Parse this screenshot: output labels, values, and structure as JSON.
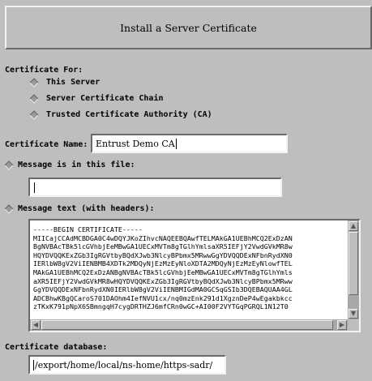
{
  "header": {
    "title": "Install a Server Certificate"
  },
  "certificate_for": {
    "label": "Certificate For:",
    "options": [
      "This Server",
      "Server Certificate Chain",
      "Trusted Certificate Authority (CA)"
    ]
  },
  "certificate_name": {
    "label": "Certificate Name:",
    "value": "Entrust Demo CA"
  },
  "message_file": {
    "label": "Message is in this file:",
    "value": ""
  },
  "message_text": {
    "label": "Message text (with headers):",
    "lines": [
      "-----BEGIN CERTIFICATE-----",
      "MIICajCCAdMCBDGA0C4wDQYJKoZIhvcNAQEEBQAwfTELMAkGA1UEBhMCQ2ExDzAN",
      "BgNVBAcTBk5lcGVhbjEeMBwGA1UECxMVTm8gTGlhYmlsaXR5IEFjY2VwdGVkMR8w",
      "HQYDVQQKExZGb3IgRGVtbyBQdXJwb3NlcyBPbmx5MRwwGgYDVQQDExNFbnRydXN0",
      "IERlbW8gV2ViIENBMB4XDTk2MDQyNjEzMzEyNloXDTA2MDQyNjEzMzEyNlowfTEL",
      "MAkGA1UEBhMCQ2ExDzANBgNVBAcTBk5lcGVhbjEeMBwGA1UECxMVTm8gTGlhYmls",
      "aXR5IEFjY2VwdGVkMR8wHQYDVQQKExZGb3IgRGVtbyBQdXJwb3NlcyBPbmx5MRww",
      "GgYDVQQDExNFbnRydXN0IERlbW8gV2ViIENBMIGdMA0GCSqGSIb3DQEBAQUAA4GL",
      "ADCBhwKBgQCaroS701DAOhm4IefNVU1cx/nq0mzEnk291d1XgznDeP4wEgakbkcc",
      "zTKxK791pNpX6SBmngqH7cygDRTHZJ6mfCRn0wGC+AI00F2VYTGqPGRQL1N12T0"
    ]
  },
  "certificate_database": {
    "label": "Certificate database:",
    "value": "/export/home/local/ns-home/https-sadr/"
  }
}
